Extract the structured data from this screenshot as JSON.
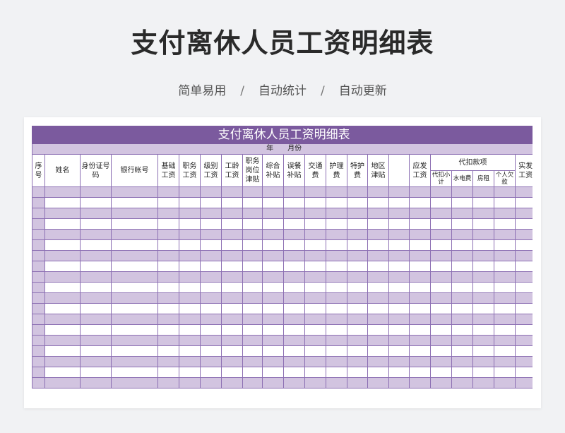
{
  "page": {
    "title": "支付离休人员工资明细表",
    "subtitle": [
      "简单易用",
      "自动统计",
      "自动更新"
    ],
    "separator": "/"
  },
  "sheet": {
    "title": "支付离休人员工资明细表",
    "date_label": "年　　月份",
    "headers": {
      "seq": "序号",
      "name": "姓名",
      "id": "身份证号码",
      "bank": "银行帐号",
      "base": "基础工资",
      "post": "职务工资",
      "grade": "级别工资",
      "age": "工龄工资",
      "post_allow": "职务岗位津贴",
      "comp": "综合补贴",
      "meal": "误餐补贴",
      "transport": "交通费",
      "nursing": "护理费",
      "special": "特护费",
      "region": "地区津贴",
      "blank": "",
      "gross": "应发工资",
      "deduct_group": "代扣款项",
      "deduct_sub": "代扣小计",
      "utilities": "水电费",
      "rent": "房租",
      "personal": "个人欠款",
      "net": "实发工资"
    },
    "row_count": 19
  },
  "colors": {
    "title_band": "#7b5a9e",
    "stripe": "#d2c4e0",
    "grid": "#8c6fb3",
    "background": "#f1f2f4"
  }
}
